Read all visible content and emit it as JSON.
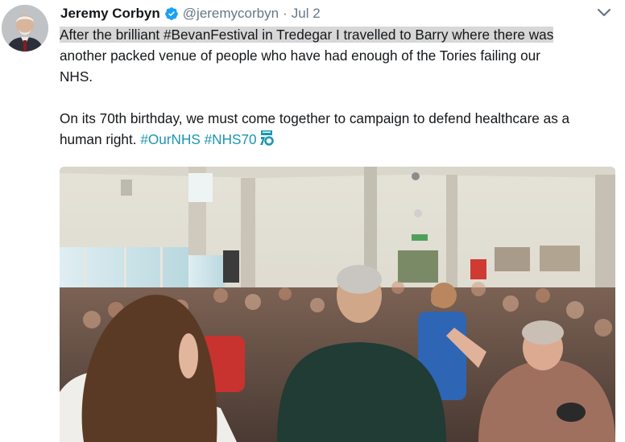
{
  "tweet": {
    "author_name": "Jeremy Corbyn",
    "handle": "@jeremycorbyn",
    "separator": "·",
    "date": "Jul 2",
    "text_line1": "After the brilliant #BevanFestival in Tredegar I travelled to Barry where there was",
    "text_line2": "another packed venue of people who have had enough of the Tories failing our",
    "text_line3": "NHS.",
    "text_p2_plain": "On its 70th birthday, we must come together to campaign to defend healthcare as a human right. ",
    "hashtag_ournhs": "#OurNHS",
    "hashtag_nhs70": "#NHS70",
    "space": " "
  },
  "icons": {
    "verified": "verified-badge-icon",
    "caret": "chevron-down-icon",
    "nhs70": "nhs70-emoji-icon"
  },
  "colors": {
    "text": "#14171a",
    "secondary": "#657786",
    "hashtag": "#1b95b1",
    "verified": "#1da1f2",
    "highlight": "#d7d7d7"
  }
}
